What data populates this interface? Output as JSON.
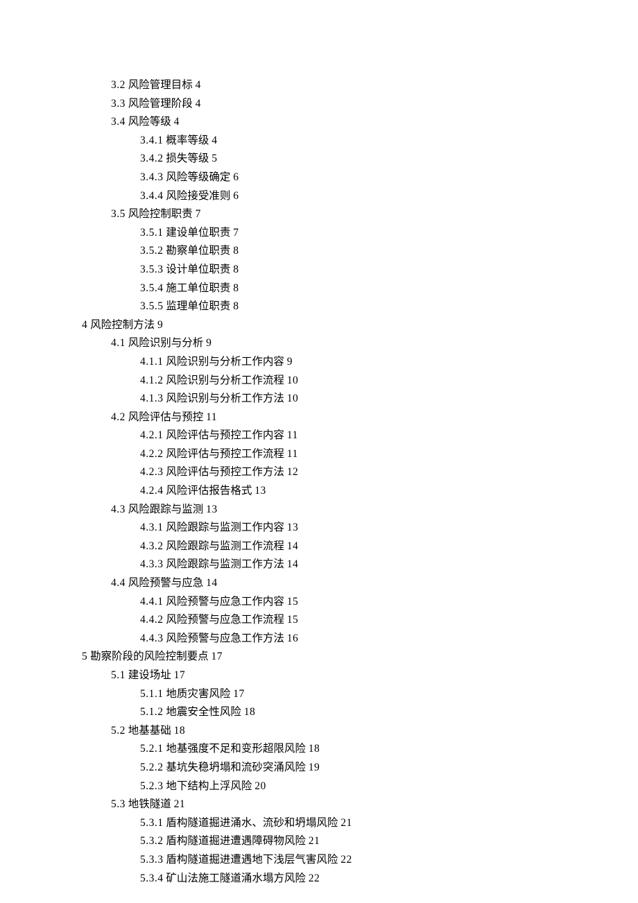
{
  "toc": [
    {
      "indent": 1,
      "num": "3.2",
      "title": "风险管理目标",
      "page": "4"
    },
    {
      "indent": 1,
      "num": "3.3",
      "title": "风险管理阶段",
      "page": "4"
    },
    {
      "indent": 1,
      "num": "3.4",
      "title": "风险等级",
      "page": "4"
    },
    {
      "indent": 2,
      "num": "3.4.1",
      "title": "概率等级",
      "page": "4"
    },
    {
      "indent": 2,
      "num": "3.4.2",
      "title": "损失等级",
      "page": "5"
    },
    {
      "indent": 2,
      "num": "3.4.3",
      "title": "风险等级确定",
      "page": "6"
    },
    {
      "indent": 2,
      "num": "3.4.4",
      "title": "风险接受准则",
      "page": "6"
    },
    {
      "indent": 1,
      "num": "3.5",
      "title": "风险控制职责",
      "page": "7"
    },
    {
      "indent": 2,
      "num": "3.5.1",
      "title": "建设单位职责",
      "page": "7"
    },
    {
      "indent": 2,
      "num": "3.5.2",
      "title": "勘察单位职责",
      "page": "8"
    },
    {
      "indent": 2,
      "num": "3.5.3",
      "title": "设计单位职责",
      "page": "8"
    },
    {
      "indent": 2,
      "num": "3.5.4",
      "title": "施工单位职责",
      "page": "8"
    },
    {
      "indent": 2,
      "num": "3.5.5",
      "title": "监理单位职责",
      "page": "8"
    },
    {
      "indent": 0,
      "num": "4",
      "title": "风险控制方法",
      "page": "9"
    },
    {
      "indent": 1,
      "num": "4.1",
      "title": "风险识别与分析",
      "page": "9"
    },
    {
      "indent": 2,
      "num": "4.1.1",
      "title": "风险识别与分析工作内容",
      "page": "9"
    },
    {
      "indent": 2,
      "num": "4.1.2",
      "title": "风险识别与分析工作流程",
      "page": "10"
    },
    {
      "indent": 2,
      "num": "4.1.3",
      "title": "风险识别与分析工作方法",
      "page": "10"
    },
    {
      "indent": 1,
      "num": "4.2",
      "title": "风险评估与预控",
      "page": "11"
    },
    {
      "indent": 2,
      "num": "4.2.1",
      "title": "风险评估与预控工作内容",
      "page": "11"
    },
    {
      "indent": 2,
      "num": "4.2.2",
      "title": "风险评估与预控工作流程",
      "page": "11"
    },
    {
      "indent": 2,
      "num": "4.2.3",
      "title": "风险评估与预控工作方法",
      "page": "12"
    },
    {
      "indent": 2,
      "num": "4.2.4",
      "title": "风险评估报告格式",
      "page": "13"
    },
    {
      "indent": 1,
      "num": "4.3",
      "title": "风险跟踪与监测",
      "page": "13"
    },
    {
      "indent": 2,
      "num": "4.3.1",
      "title": "风险跟踪与监测工作内容",
      "page": "13"
    },
    {
      "indent": 2,
      "num": "4.3.2",
      "title": "风险跟踪与监测工作流程",
      "page": "14"
    },
    {
      "indent": 2,
      "num": "4.3.3",
      "title": "风险跟踪与监测工作方法",
      "page": "14"
    },
    {
      "indent": 1,
      "num": "4.4",
      "title": "风险预警与应急",
      "page": "14"
    },
    {
      "indent": 2,
      "num": "4.4.1",
      "title": "风险预警与应急工作内容",
      "page": "15"
    },
    {
      "indent": 2,
      "num": "4.4.2",
      "title": "风险预警与应急工作流程",
      "page": "15"
    },
    {
      "indent": 2,
      "num": "4.4.3",
      "title": "风险预警与应急工作方法",
      "page": "16"
    },
    {
      "indent": 0,
      "num": "5",
      "title": "勘察阶段的风险控制要点",
      "page": "17"
    },
    {
      "indent": 1,
      "num": "5.1",
      "title": "建设场址",
      "page": "17"
    },
    {
      "indent": 2,
      "num": "5.1.1",
      "title": "地质灾害风险",
      "page": "17"
    },
    {
      "indent": 2,
      "num": "5.1.2",
      "title": "地震安全性风险",
      "page": "18"
    },
    {
      "indent": 1,
      "num": "5.2",
      "title": "地基基础",
      "page": "18"
    },
    {
      "indent": 2,
      "num": "5.2.1",
      "title": "地基强度不足和变形超限风险",
      "page": "18"
    },
    {
      "indent": 2,
      "num": "5.2.2",
      "title": "基坑失稳坍塌和流砂突涌风险",
      "page": "19"
    },
    {
      "indent": 2,
      "num": "5.2.3",
      "title": "地下结构上浮风险",
      "page": "20"
    },
    {
      "indent": 1,
      "num": "5.3",
      "title": "地铁隧道",
      "page": "21"
    },
    {
      "indent": 2,
      "num": "5.3.1",
      "title": "盾构隧道掘进涌水、流砂和坍塌风险",
      "page": "21"
    },
    {
      "indent": 2,
      "num": "5.3.2",
      "title": "盾构隧道掘进遭遇障碍物风险",
      "page": "21"
    },
    {
      "indent": 2,
      "num": "5.3.3",
      "title": "盾构隧道掘进遭遇地下浅层气害风险",
      "page": "22"
    },
    {
      "indent": 2,
      "num": "5.3.4",
      "title": "矿山法施工隧道涌水塌方风险",
      "page": "22"
    }
  ]
}
